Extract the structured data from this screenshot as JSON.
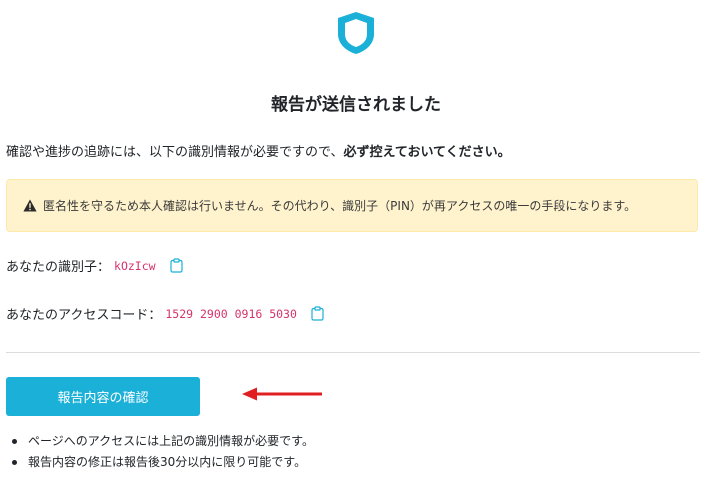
{
  "header": {
    "logo_icon": "shield-icon",
    "logo_color": "#1ab0d8",
    "title": "報告が送信されました"
  },
  "intro": {
    "text": "確認や進捗の追跡には、以下の識別情報が必要ですので、",
    "emphasis": "必ず控えておいてください。"
  },
  "warning": {
    "icon": "warning-triangle-icon",
    "text": "匿名性を守るため本人確認は行いません。その代わり、識別子（PIN）が再アクセスの唯一の手段になります。",
    "background": "#fff3cd"
  },
  "identifier": {
    "label": "あなたの識別子：",
    "value": "kOzIcw",
    "copy_icon": "clipboard-icon"
  },
  "access_code": {
    "label": "あなたのアクセスコード：",
    "value": "1529 2900 0916 5030",
    "copy_icon": "clipboard-icon"
  },
  "actions": {
    "confirm_label": "報告内容の確認",
    "accent": "#1ab0d8",
    "annotation_arrow_color": "#e02020"
  },
  "notes": [
    "ページへのアクセスには上記の識別情報が必要です。",
    "報告内容の修正は報告後30分以内に限り可能です。"
  ]
}
